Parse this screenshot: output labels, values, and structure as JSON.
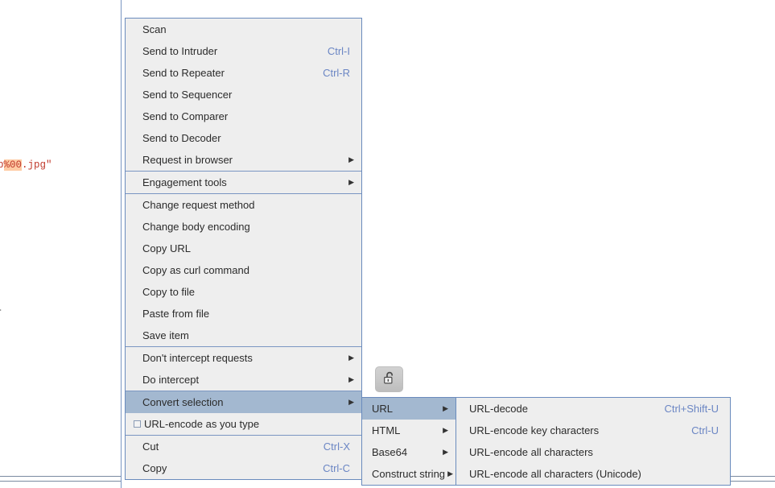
{
  "background": {
    "code_fragment_top": ";",
    "code_fragment_mid_prefix": "php",
    "code_fragment_mid_highlight": "%00",
    "code_fragment_mid_suffix": ".jpg\"",
    "code_fragment_dash": "-",
    "highlight_color": "#ffcba4",
    "code_color": "#c0392b"
  },
  "lock_button": {
    "icon": "unlocked-padlock-icon",
    "state": "unlocked"
  },
  "context_menu": {
    "accent_selection_color": "#a3b8d0",
    "border_color": "#6a8bbd",
    "background_color": "#eeeeee",
    "accel_color": "#6b86c4",
    "items": [
      {
        "label": "Scan",
        "accel": "",
        "arrow": false,
        "separator_after": false
      },
      {
        "label": "Send to Intruder",
        "accel": "Ctrl-I",
        "arrow": false,
        "separator_after": false
      },
      {
        "label": "Send to Repeater",
        "accel": "Ctrl-R",
        "arrow": false,
        "separator_after": false
      },
      {
        "label": "Send to Sequencer",
        "accel": "",
        "arrow": false,
        "separator_after": false
      },
      {
        "label": "Send to Comparer",
        "accel": "",
        "arrow": false,
        "separator_after": false
      },
      {
        "label": "Send to Decoder",
        "accel": "",
        "arrow": false,
        "separator_after": false
      },
      {
        "label": "Request in browser",
        "accel": "",
        "arrow": true,
        "separator_after": true
      },
      {
        "label": "Engagement tools",
        "accel": "",
        "arrow": true,
        "separator_after": true
      },
      {
        "label": "Change request method",
        "accel": "",
        "arrow": false,
        "separator_after": false
      },
      {
        "label": "Change body encoding",
        "accel": "",
        "arrow": false,
        "separator_after": false
      },
      {
        "label": "Copy URL",
        "accel": "",
        "arrow": false,
        "separator_after": false
      },
      {
        "label": "Copy as curl command",
        "accel": "",
        "arrow": false,
        "separator_after": false
      },
      {
        "label": "Copy to file",
        "accel": "",
        "arrow": false,
        "separator_after": false
      },
      {
        "label": "Paste from file",
        "accel": "",
        "arrow": false,
        "separator_after": false
      },
      {
        "label": "Save item",
        "accel": "",
        "arrow": false,
        "separator_after": true
      },
      {
        "label": "Don't intercept requests",
        "accel": "",
        "arrow": true,
        "separator_after": false
      },
      {
        "label": "Do intercept",
        "accel": "",
        "arrow": true,
        "separator_after": true
      },
      {
        "label": "Convert selection",
        "accel": "",
        "arrow": true,
        "separator_after": false,
        "selected": true
      },
      {
        "label": "URL-encode as you type",
        "accel": "",
        "arrow": false,
        "separator_after": true,
        "checkbox": true,
        "checked": false
      },
      {
        "label": "Cut",
        "accel": "Ctrl-X",
        "arrow": false,
        "separator_after": false
      },
      {
        "label": "Copy",
        "accel": "Ctrl-C",
        "arrow": false,
        "separator_after": false
      }
    ]
  },
  "submenu_convert": {
    "items": [
      {
        "label": "URL",
        "accel": "",
        "arrow": true,
        "selected": true
      },
      {
        "label": "HTML",
        "accel": "",
        "arrow": true
      },
      {
        "label": "Base64",
        "accel": "",
        "arrow": true
      },
      {
        "label": "Construct string",
        "accel": "",
        "arrow": true
      }
    ]
  },
  "submenu_url": {
    "items": [
      {
        "label": "URL-decode",
        "accel": "Ctrl+Shift-U",
        "arrow": false
      },
      {
        "label": "URL-encode key characters",
        "accel": "Ctrl-U",
        "arrow": false
      },
      {
        "label": "URL-encode all characters",
        "accel": "",
        "arrow": false
      },
      {
        "label": "URL-encode all characters (Unicode)",
        "accel": "",
        "arrow": false
      }
    ]
  }
}
